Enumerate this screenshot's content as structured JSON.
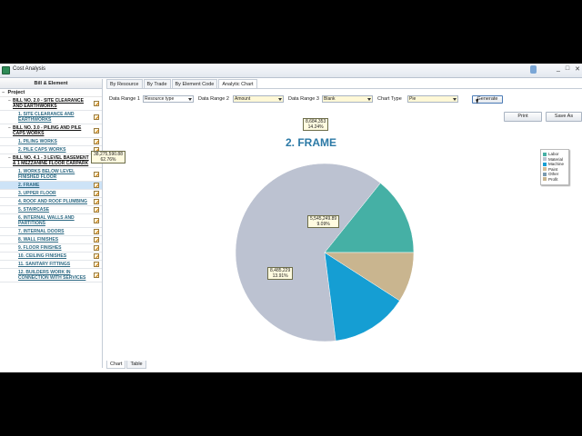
{
  "window": {
    "title": "Cost Analysis",
    "controls": [
      "_",
      "□",
      "✕"
    ]
  },
  "left_panel": {
    "header": "Bill & Element",
    "project_label": "Project",
    "project_toggle": "−",
    "items": [
      {
        "label": "BILL NO. 2.0 - SITE CLEARANCE AND EARTHWORKS",
        "type": "bill",
        "toggle": "−"
      },
      {
        "label": "1. SITE CLEARANCE AND EARTHWORKS",
        "type": "element"
      },
      {
        "label": "BILL NO. 3.0 - PILING AND PILE CAPS WORKS",
        "type": "bill",
        "toggle": "−"
      },
      {
        "label": "1. PILING WORKS",
        "type": "element"
      },
      {
        "label": "2. PILE CAPS WORKS",
        "type": "element"
      },
      {
        "label": "BILL NO. 4.1 - 3 LEVEL BASEMENT & 1 MEZZANINE FLOOR CARPARK",
        "type": "bill",
        "toggle": "−"
      },
      {
        "label": "1. WORKS BELOW LEVEL FINISHED FLOOR",
        "type": "element"
      },
      {
        "label": "2. FRAME",
        "type": "element",
        "selected": true
      },
      {
        "label": "3. UPPER FLOOR",
        "type": "element"
      },
      {
        "label": "4. ROOF AND ROOF PLUMBING",
        "type": "element"
      },
      {
        "label": "5. STAIRCASE",
        "type": "element"
      },
      {
        "label": "6. INTERNAL WALLS AND PARTITIONS",
        "type": "element"
      },
      {
        "label": "7. INTERNAL DOORS",
        "type": "element"
      },
      {
        "label": "8. WALL FINISHES",
        "type": "element"
      },
      {
        "label": "9. FLOOR FINISHES",
        "type": "element"
      },
      {
        "label": "10. CEILING FINISHES",
        "type": "element"
      },
      {
        "label": "11. SANITARY FITTINGS",
        "type": "element"
      },
      {
        "label": "12. BUILDERS WORK IN CONNECTION WITH SERVICES",
        "type": "element"
      }
    ]
  },
  "tabs": [
    "By Resource",
    "By Trade",
    "By Element Code",
    "Analytic Chart"
  ],
  "active_tab": 3,
  "controls": {
    "range1_label": "Data Range 1",
    "range1_value": "Resource type",
    "range2_label": "Data Range 2",
    "range2_value": "Amount",
    "range3_label": "Data Range 3",
    "range3_value": "Blank",
    "chart_type_label": "Chart Type",
    "chart_type_value": "Pie",
    "generate": "Generate",
    "print": "Print",
    "save_as": "Save As"
  },
  "bottom_tabs": [
    "Chart",
    "Table"
  ],
  "chart_data": {
    "type": "pie",
    "title": "2. FRAME",
    "categories": [
      "Labor",
      "Material",
      "Machine",
      "Paint",
      "Other",
      "Profit"
    ],
    "colors": [
      "#45b0a5",
      "#bcc2d1",
      "#159ed3",
      "#d5bd97",
      "#7a9ab0",
      "#c9b58f"
    ],
    "values": [
      8684353,
      38275590.88,
      8485229,
      0,
      0,
      5545249.89
    ],
    "percents": [
      14.24,
      62.76,
      13.91,
      0,
      0,
      9.09
    ],
    "labels": [
      {
        "value": "8,684,353",
        "pct": "14.24%"
      },
      {
        "value": "38,275,590.88",
        "pct": "62.76%"
      },
      {
        "value": "8,485,229",
        "pct": "13.91%"
      },
      null,
      null,
      {
        "value": "5,545,249.89",
        "pct": "9.09%"
      }
    ],
    "legend_placement": "top-right"
  }
}
